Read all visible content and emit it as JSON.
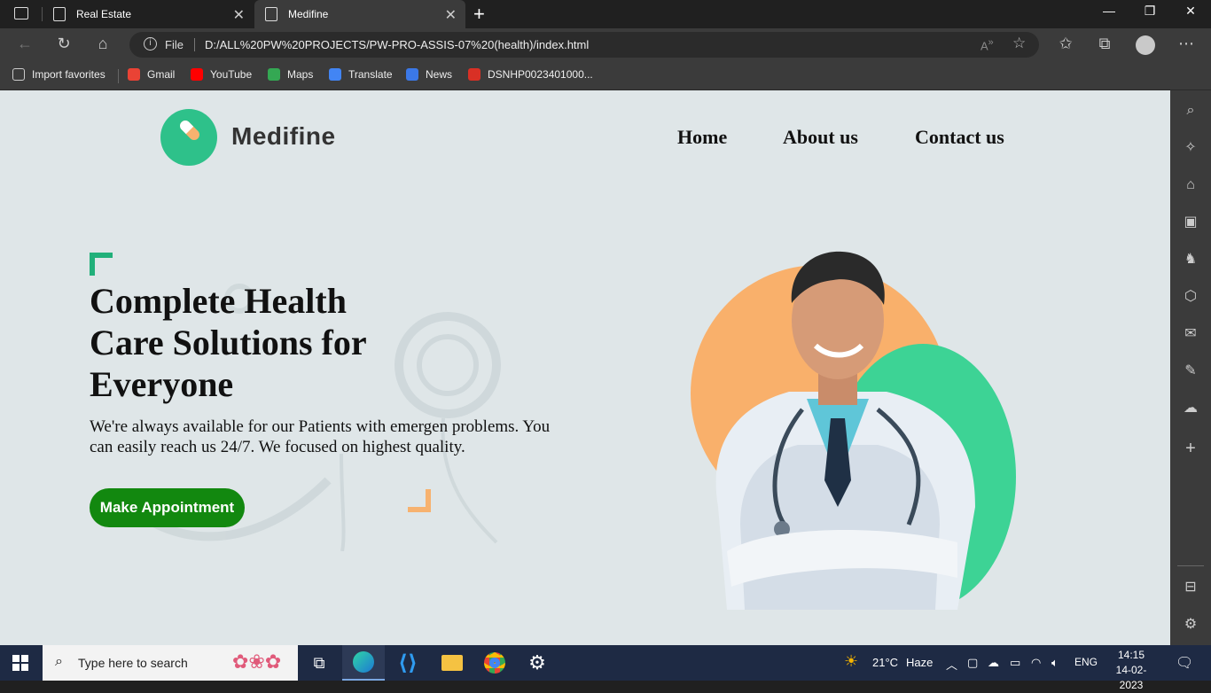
{
  "browser": {
    "tabs": [
      {
        "title": "Real Estate",
        "active": false
      },
      {
        "title": "Medifine",
        "active": true
      }
    ],
    "address": {
      "scheme_label": "File",
      "url": "D:/ALL%20PW%20PROJECTS/PW-PRO-ASSIS-07%20(health)/index.html"
    },
    "bookmarks": [
      {
        "label": "Import favorites",
        "icon": "import-icon",
        "color": "#cccccc"
      },
      {
        "label": "Gmail",
        "icon": "gmail-icon",
        "color": "#ea4335"
      },
      {
        "label": "YouTube",
        "icon": "youtube-icon",
        "color": "#ff0000"
      },
      {
        "label": "Maps",
        "icon": "maps-icon",
        "color": "#34a853"
      },
      {
        "label": "Translate",
        "icon": "translate-icon",
        "color": "#4285f4"
      },
      {
        "label": "News",
        "icon": "news-icon",
        "color": "#3b78e7"
      },
      {
        "label": "DSNHP0023401000...",
        "icon": "pdf-icon",
        "color": "#d93025"
      }
    ]
  },
  "page": {
    "logo": {
      "text": "Medifine",
      "accent": "#2ec18a"
    },
    "nav": [
      {
        "label": "Home"
      },
      {
        "label": "About us"
      },
      {
        "label": "Contact us"
      }
    ],
    "hero": {
      "title": "Complete Health Care Solutions for Everyone",
      "description": "We're always available for our Patients with emergen problems. You can easily reach us 24/7. We focused on highest quality.",
      "cta_label": "Make Appointment"
    },
    "colors": {
      "background": "#dfe6e8",
      "cta": "#12880f",
      "orange": "#f9b06b",
      "green": "#3dd395"
    }
  },
  "taskbar": {
    "search_placeholder": "Type here to search",
    "weather": {
      "temp": "21°C",
      "condition": "Haze"
    },
    "language": "ENG",
    "time": "14:15",
    "date": "14-02-2023"
  }
}
